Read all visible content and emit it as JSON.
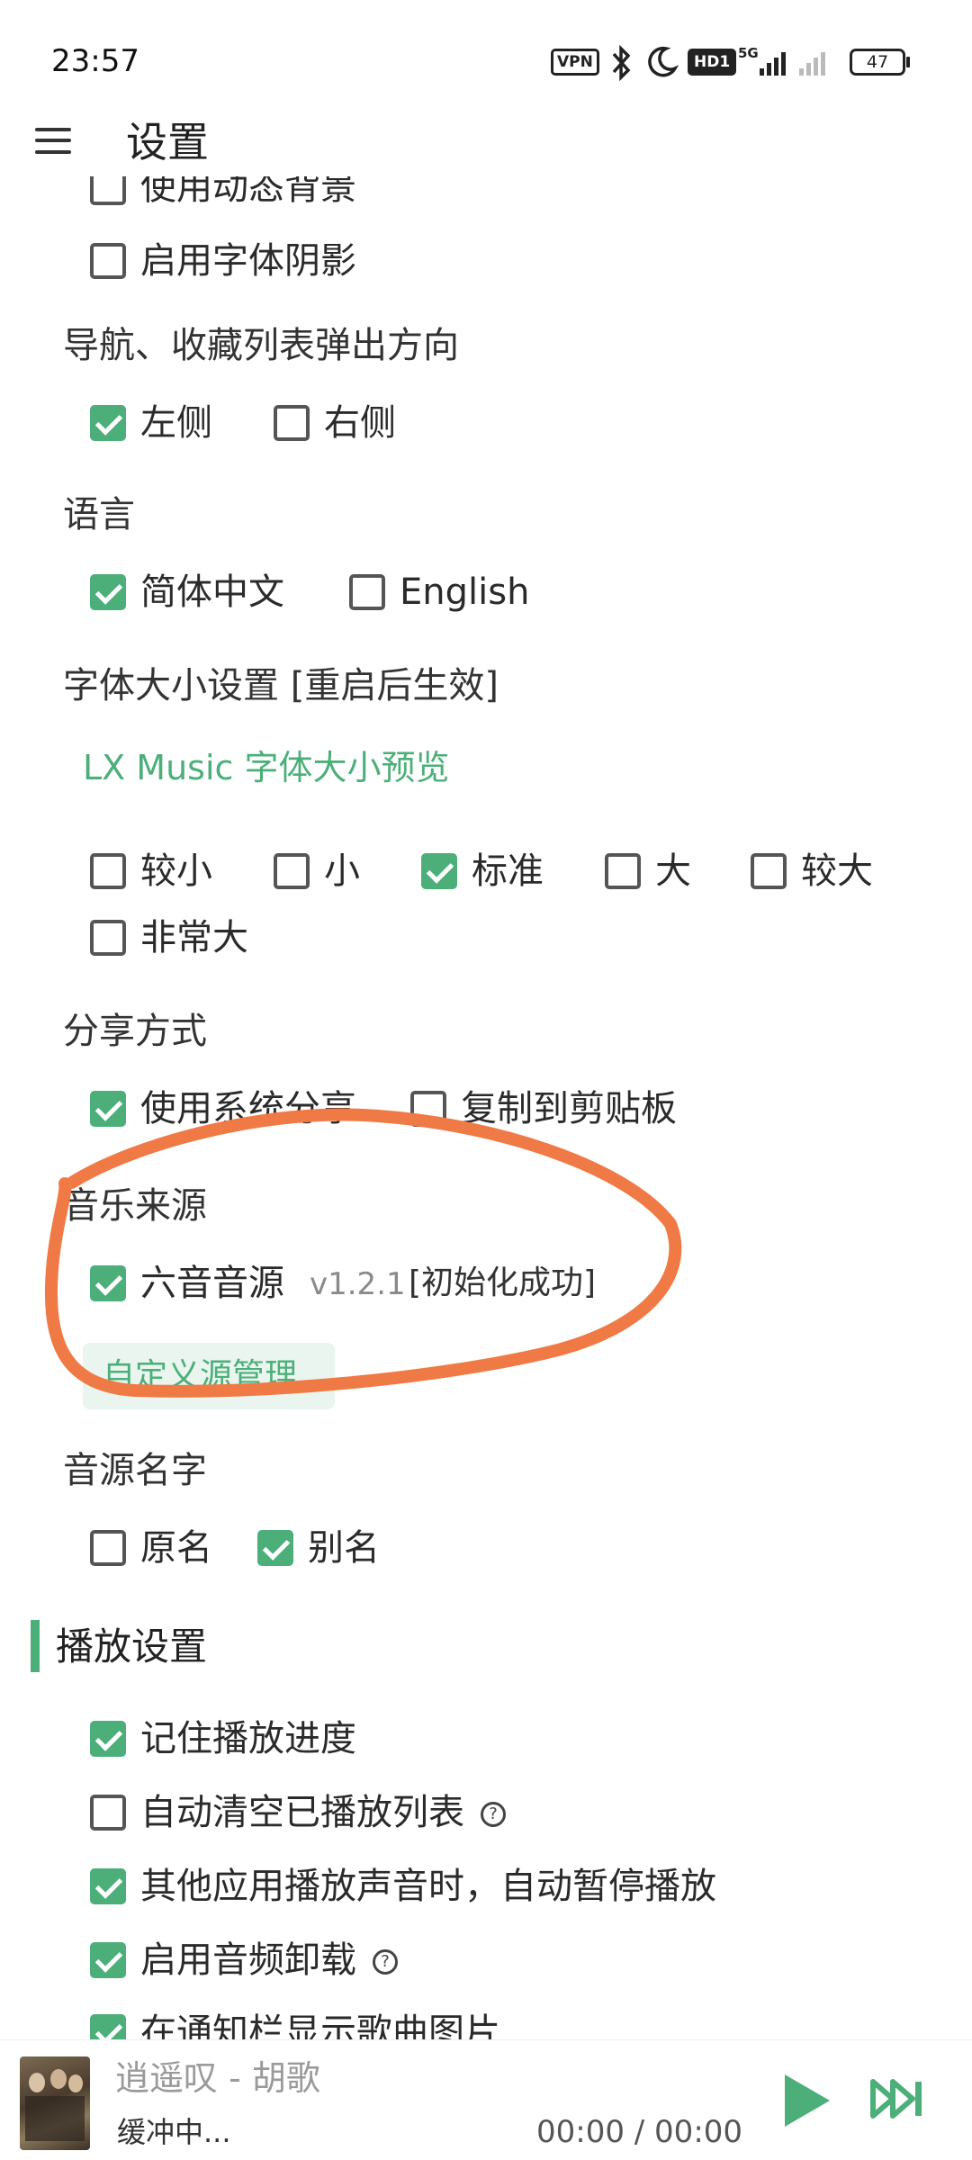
{
  "status_bar": {
    "time": "23:57",
    "vpn": "VPN",
    "hd": "HD1",
    "network": "5G",
    "battery": "47",
    "icons": [
      "bluetooth-icon",
      "moon-icon",
      "signal-icon",
      "signal-weak-icon",
      "battery-icon"
    ]
  },
  "header": {
    "title": "设置",
    "menu_icon": "hamburger-menu-icon"
  },
  "settings": {
    "dynamic_bg": "使用动态背景",
    "font_shadow": "启用字体阴影",
    "nav_direction": {
      "label": "导航、收藏列表弹出方向",
      "options": [
        {
          "label": "左侧",
          "checked": true
        },
        {
          "label": "右侧",
          "checked": false
        }
      ]
    },
    "language": {
      "label": "语言",
      "options": [
        {
          "label": "简体中文",
          "checked": true
        },
        {
          "label": "English",
          "checked": false
        }
      ]
    },
    "font_size": {
      "label": "字体大小设置 [重启后生效]",
      "preview": "LX Music 字体大小预览",
      "options": [
        {
          "label": "较小",
          "checked": false
        },
        {
          "label": "小",
          "checked": false
        },
        {
          "label": "标准",
          "checked": true
        },
        {
          "label": "大",
          "checked": false
        },
        {
          "label": "较大",
          "checked": false
        },
        {
          "label": "非常大",
          "checked": false
        }
      ]
    },
    "share": {
      "label": "分享方式",
      "options": [
        {
          "label": "使用系统分享",
          "checked": true
        },
        {
          "label": "复制到剪贴板",
          "checked": false
        }
      ]
    },
    "music_source": {
      "label": "音乐来源",
      "source_name": "六音音源",
      "version": "v1.2.1",
      "status": "[初始化成功]",
      "checked": true,
      "custom_button": "自定义源管理",
      "annotation_color": "#f07a45"
    },
    "source_name_display": {
      "label": "音源名字",
      "options": [
        {
          "label": "原名",
          "checked": false
        },
        {
          "label": "别名",
          "checked": true
        }
      ]
    },
    "playback": {
      "section_title": "播放设置",
      "items": [
        {
          "label": "记住播放进度",
          "checked": true,
          "help": false
        },
        {
          "label": "自动清空已播放列表",
          "checked": false,
          "help": true
        },
        {
          "label": "其他应用播放声音时，自动暂停播放",
          "checked": true,
          "help": false
        },
        {
          "label": "启用音频卸载",
          "checked": true,
          "help": true
        },
        {
          "label": "在通知栏显示歌曲图片",
          "checked": true,
          "help": false
        }
      ],
      "help_mark": "?"
    }
  },
  "player": {
    "title": "逍遥叹 - 胡歌",
    "status": "缓冲中...",
    "time": "00:00 / 00:00",
    "accent": "#4caf79"
  }
}
